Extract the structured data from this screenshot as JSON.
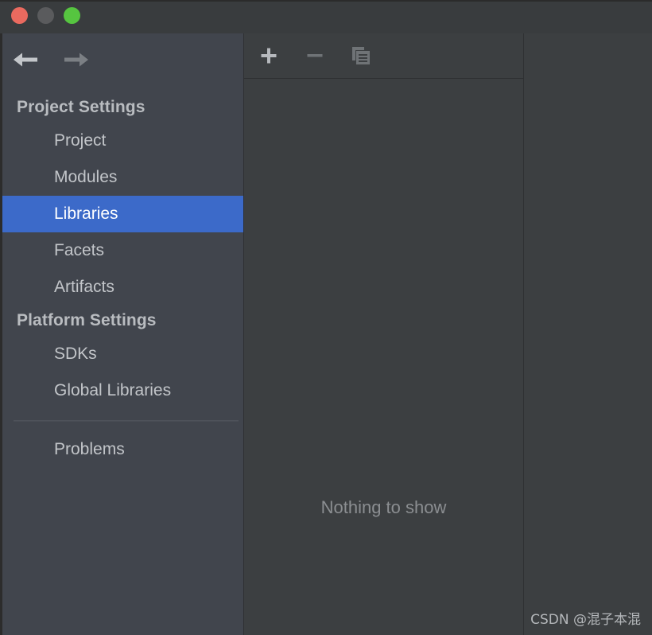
{
  "window": {
    "titlebar": {
      "buttons": [
        {
          "name": "close-button",
          "icon": "close-traffic-light",
          "color": "#ea6a5f"
        },
        {
          "name": "minimize-button",
          "icon": "minimize-traffic-light",
          "color": "#5a5b5d"
        },
        {
          "name": "maximize-button",
          "icon": "maximize-traffic-light",
          "color": "#56c540"
        }
      ]
    }
  },
  "sidebar": {
    "nav": {
      "back_icon": "arrow-left-icon",
      "forward_icon": "arrow-right-icon"
    },
    "groups": [
      {
        "title": "Project Settings",
        "items": [
          {
            "label": "Project",
            "selected": false
          },
          {
            "label": "Modules",
            "selected": false
          },
          {
            "label": "Libraries",
            "selected": true
          },
          {
            "label": "Facets",
            "selected": false
          },
          {
            "label": "Artifacts",
            "selected": false
          }
        ]
      },
      {
        "title": "Platform Settings",
        "items": [
          {
            "label": "SDKs",
            "selected": false
          },
          {
            "label": "Global Libraries",
            "selected": false
          }
        ]
      }
    ],
    "footer_items": [
      {
        "label": "Problems",
        "selected": false
      }
    ]
  },
  "list_panel": {
    "toolbar": {
      "add_label": "Add",
      "add_icon": "plus-icon",
      "remove_label": "Remove",
      "remove_icon": "minus-icon",
      "copy_label": "Copy",
      "copy_icon": "copy-icon"
    },
    "empty_message": "Nothing to show"
  },
  "detail_panel": {
    "content": ""
  },
  "watermark": {
    "text": "CSDN @混子本混"
  },
  "colors": {
    "titlebar_bg": "#393c3e",
    "sidebar_bg": "#41454d",
    "panel_bg": "#3c3f41",
    "selection_blue": "#3c6ac9",
    "text_primary": "#c2c5c9",
    "text_heading": "#b9bcc0",
    "text_muted": "#8b8e91",
    "divider": "#2e3032"
  }
}
